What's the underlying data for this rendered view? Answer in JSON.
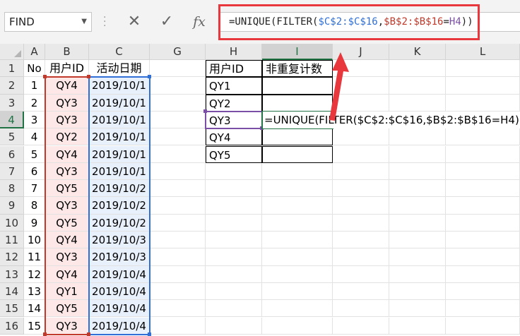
{
  "name_box": {
    "value": "FIND"
  },
  "formula_bar": {
    "cancel_glyph": "✕",
    "enter_glyph": "✓",
    "fx_label": "fx",
    "parts": [
      "=UNIQUE(FILTER(",
      "$C$2:$C$16",
      ",",
      "$B$2:$B$16",
      "=",
      "H4",
      "))"
    ]
  },
  "columns": [
    "A",
    "B",
    "C",
    "G",
    "H",
    "I",
    "J",
    "K",
    "L"
  ],
  "rows": [
    "1",
    "2",
    "3",
    "4",
    "5",
    "6",
    "7",
    "8",
    "9",
    "10",
    "11",
    "12",
    "13",
    "14",
    "15",
    "16"
  ],
  "headers": {
    "no": "No",
    "user_id": "用户ID",
    "date": "活动日期"
  },
  "data_rows": [
    {
      "no": "1",
      "id": "QY4",
      "date": "2019/10/1"
    },
    {
      "no": "2",
      "id": "QY3",
      "date": "2019/10/1"
    },
    {
      "no": "3",
      "id": "QY3",
      "date": "2019/10/1"
    },
    {
      "no": "4",
      "id": "QY2",
      "date": "2019/10/1"
    },
    {
      "no": "5",
      "id": "QY4",
      "date": "2019/10/1"
    },
    {
      "no": "6",
      "id": "QY3",
      "date": "2019/10/1"
    },
    {
      "no": "7",
      "id": "QY5",
      "date": "2019/10/2"
    },
    {
      "no": "8",
      "id": "QY3",
      "date": "2019/10/2"
    },
    {
      "no": "9",
      "id": "QY5",
      "date": "2019/10/2"
    },
    {
      "no": "10",
      "id": "QY4",
      "date": "2019/10/3"
    },
    {
      "no": "11",
      "id": "QY3",
      "date": "2019/10/3"
    },
    {
      "no": "12",
      "id": "QY4",
      "date": "2019/10/4"
    },
    {
      "no": "13",
      "id": "QY1",
      "date": "2019/10/4"
    },
    {
      "no": "14",
      "id": "QY5",
      "date": "2019/10/4"
    },
    {
      "no": "15",
      "id": "QY3",
      "date": "2019/10/4"
    }
  ],
  "result_table": {
    "header_id": "用户ID",
    "header_count": "非重复计数",
    "ids": [
      "QY1",
      "QY2",
      "QY3",
      "QY4",
      "QY5"
    ]
  },
  "editing_text": "=UNIQUE(FILTER($C$2:$C$16,$B$2:$B$16=H4))",
  "colors": {
    "highlight_box": "#e8383d",
    "range_b": "#c0392b",
    "range_c": "#2f6fd6",
    "range_h": "#7b4fa6",
    "active": "#217346"
  }
}
